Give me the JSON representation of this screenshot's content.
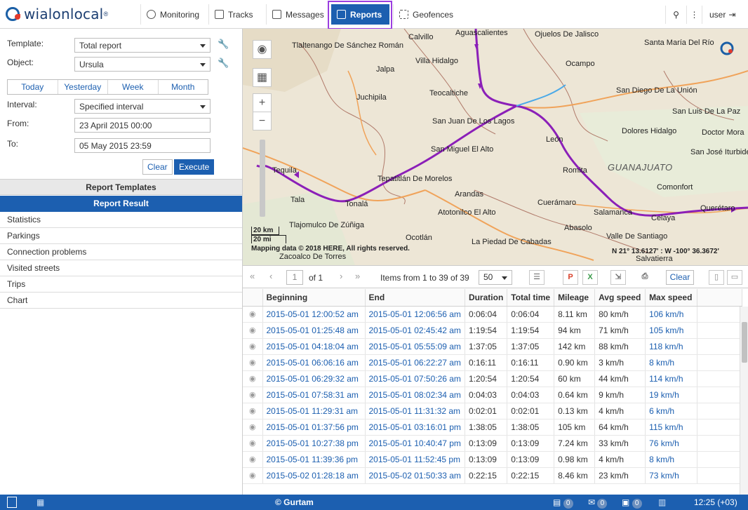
{
  "app": {
    "logo_text": "wialonlocal",
    "logo_mark": "®"
  },
  "nav": {
    "monitoring": "Monitoring",
    "tracks": "Tracks",
    "messages": "Messages",
    "reports": "Reports",
    "geofences": "Geofences"
  },
  "topright": {
    "search_icon": "⚲",
    "menu_icon": "⋮",
    "user": "user"
  },
  "form": {
    "template_label": "Template:",
    "template_value": "Total report",
    "object_label": "Object:",
    "object_value": "Ursula",
    "periods": [
      "Today",
      "Yesterday",
      "Week",
      "Month"
    ],
    "interval_label": "Interval:",
    "interval_value": "Specified interval",
    "from_label": "From:",
    "from_value": "23 April 2015 00:00",
    "to_label": "To:",
    "to_value": "05 May 2015 23:59",
    "clear_button": "Clear",
    "execute_button": "Execute"
  },
  "sections": {
    "templates": "Report Templates",
    "result": "Report Result"
  },
  "result_items": [
    "Statistics",
    "Parkings",
    "Connection problems",
    "Visited streets",
    "Trips",
    "Chart"
  ],
  "map": {
    "labels": [
      "Calvillo",
      "Aguascalientes",
      "Ojuelos De Jalisco",
      "Santa María Del Río",
      "Tlaltenango De Sánchez Román",
      "Villa Hidalgo",
      "Ocampo",
      "Jalpa",
      "Juchipila",
      "Teocaltiche",
      "San Diego De La Unión",
      "San Luis De La Paz",
      "San Juan De Los Lagos",
      "Dolores Hidalgo",
      "Doctor Mora",
      "León",
      "San Miguel El Alto",
      "San José Iturbide",
      "Tequila",
      "Romita",
      "GUANAJUATO",
      "Tepatitlán De Morelos",
      "Arandas",
      "Comonfort",
      "Tala",
      "Tonalá",
      "Cuerámaro",
      "Salamanca",
      "Querétaro",
      "Atotonilco El Alto",
      "Celaya",
      "Tlajomulco De Zúñiga",
      "Abasolo",
      "Valle De Santiago",
      "Ocotlán",
      "La Piedad De Cabadas",
      "Zacoalco De Torres",
      "Salvatierra"
    ],
    "scale_km": "20 km",
    "scale_mi": "20 mi",
    "copyright": "Mapping data © 2018 HERE, All rights reserved.",
    "coordinates": "N 21° 13.6127' : W -100° 36.3672'",
    "zoom_in": "+",
    "zoom_out": "−"
  },
  "toolbar": {
    "page": "1",
    "of_pages": "of 1",
    "items_text": "Items from 1 to 39 of 39",
    "per_page": "50",
    "clear_button": "Clear"
  },
  "table": {
    "columns": [
      "Beginning",
      "End",
      "Duration",
      "Total time",
      "Mileage",
      "Avg speed",
      "Max speed"
    ],
    "rows": [
      [
        "2015-05-01 12:00:52 am",
        "2015-05-01 12:06:56 am",
        "0:06:04",
        "0:06:04",
        "8.11 km",
        "80 km/h",
        "106 km/h"
      ],
      [
        "2015-05-01 01:25:48 am",
        "2015-05-01 02:45:42 am",
        "1:19:54",
        "1:19:54",
        "94 km",
        "71 km/h",
        "105 km/h"
      ],
      [
        "2015-05-01 04:18:04 am",
        "2015-05-01 05:55:09 am",
        "1:37:05",
        "1:37:05",
        "142 km",
        "88 km/h",
        "118 km/h"
      ],
      [
        "2015-05-01 06:06:16 am",
        "2015-05-01 06:22:27 am",
        "0:16:11",
        "0:16:11",
        "0.90 km",
        "3 km/h",
        "8 km/h"
      ],
      [
        "2015-05-01 06:29:32 am",
        "2015-05-01 07:50:26 am",
        "1:20:54",
        "1:20:54",
        "60 km",
        "44 km/h",
        "114 km/h"
      ],
      [
        "2015-05-01 07:58:31 am",
        "2015-05-01 08:02:34 am",
        "0:04:03",
        "0:04:03",
        "0.64 km",
        "9 km/h",
        "19 km/h"
      ],
      [
        "2015-05-01 11:29:31 am",
        "2015-05-01 11:31:32 am",
        "0:02:01",
        "0:02:01",
        "0.13 km",
        "4 km/h",
        "6 km/h"
      ],
      [
        "2015-05-01 01:37:56 pm",
        "2015-05-01 03:16:01 pm",
        "1:38:05",
        "1:38:05",
        "105 km",
        "64 km/h",
        "115 km/h"
      ],
      [
        "2015-05-01 10:27:38 pm",
        "2015-05-01 10:40:47 pm",
        "0:13:09",
        "0:13:09",
        "7.24 km",
        "33 km/h",
        "76 km/h"
      ],
      [
        "2015-05-01 11:39:36 pm",
        "2015-05-01 11:52:45 pm",
        "0:13:09",
        "0:13:09",
        "0.98 km",
        "4 km/h",
        "8 km/h"
      ],
      [
        "2015-05-02 01:28:18 am",
        "2015-05-02 01:50:33 am",
        "0:22:15",
        "0:22:15",
        "8.46 km",
        "23 km/h",
        "73 km/h"
      ]
    ]
  },
  "bottombar": {
    "copyright": "© Gurtam",
    "badge1": "0",
    "badge2": "0",
    "badge3": "0",
    "time": "12:25 (+03)"
  },
  "colors": {
    "accent": "#1c5fb0",
    "highlight": "#9b3ee0",
    "track": "#8b1fb8"
  }
}
